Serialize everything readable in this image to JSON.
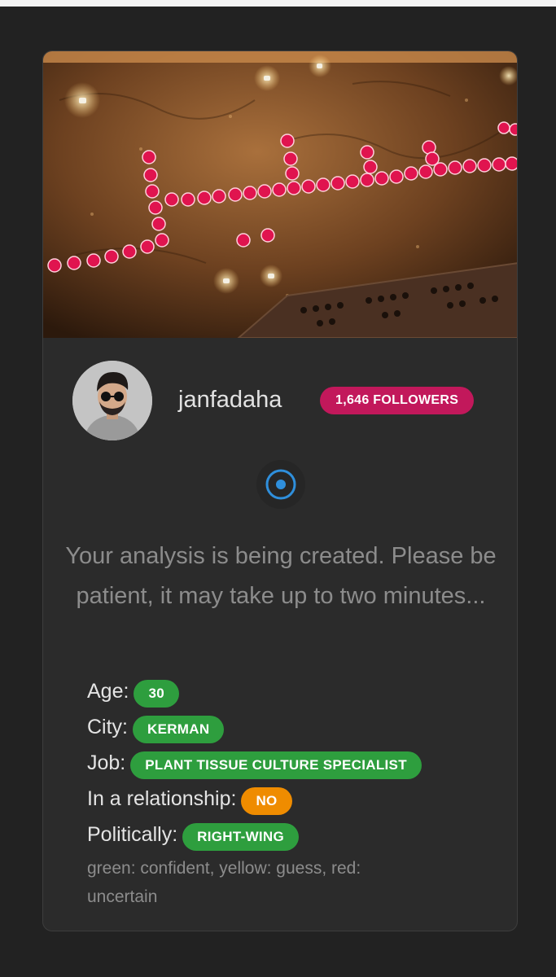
{
  "profile": {
    "username": "janfadaha",
    "followers_label": "1,646 FOLLOWERS"
  },
  "status": {
    "message": "Your analysis is being created. Please be patient, it may take up to two minutes..."
  },
  "details": [
    {
      "label": "Age:",
      "value": "30",
      "confidence": "green"
    },
    {
      "label": "City:",
      "value": "KERMAN",
      "confidence": "green"
    },
    {
      "label": "Job:",
      "value": "PLANT TISSUE CULTURE SPECIALIST",
      "confidence": "green"
    },
    {
      "label": "In a relationship:",
      "value": "NO",
      "confidence": "yellow"
    },
    {
      "label": "Politically:",
      "value": "RIGHT-WING",
      "confidence": "green"
    }
  ],
  "legend": "green: confident, yellow: guess, red: uncertain",
  "colors": {
    "page_background": "#222222",
    "card_background": "#2b2b2b",
    "followers_badge": "#c2185b",
    "confidence_green": "#2e9e3e",
    "confidence_yellow": "#ef8c00",
    "spinner_accent": "#2f8fdc"
  },
  "icons": {
    "loading": "loading-spinner-icon"
  }
}
